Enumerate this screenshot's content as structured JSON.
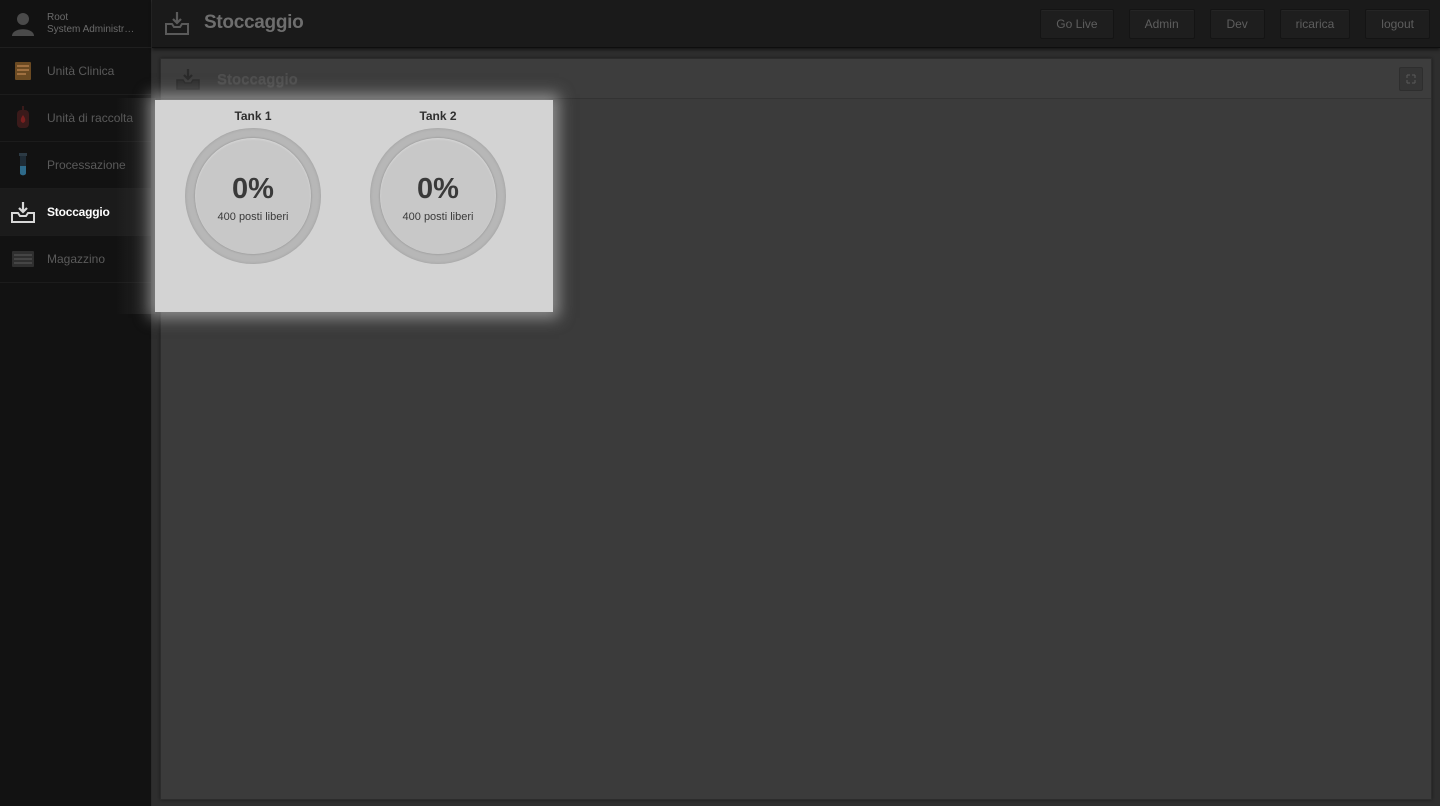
{
  "user": {
    "name": "Root",
    "role": "System Administr…"
  },
  "sidebar": {
    "items": [
      {
        "label": "Unità Clinica",
        "icon": "clipboard-icon",
        "active": false
      },
      {
        "label": "Unità di raccolta",
        "icon": "blood-bag-icon",
        "active": false
      },
      {
        "label": "Processazione",
        "icon": "test-tube-icon",
        "active": false
      },
      {
        "label": "Stoccaggio",
        "icon": "inbox-download-icon",
        "active": true
      },
      {
        "label": "Magazzino",
        "icon": "archive-icon",
        "active": false
      }
    ]
  },
  "topbar": {
    "title": "Stoccaggio",
    "buttons": [
      "Go Live",
      "Admin",
      "Dev",
      "ricarica",
      "logout"
    ]
  },
  "panel": {
    "title": "Stoccaggio",
    "tanks": [
      {
        "name": "Tank 1",
        "percent": "0%",
        "free": "400 posti liberi"
      },
      {
        "name": "Tank 2",
        "percent": "0%",
        "free": "400 posti liberi"
      }
    ]
  },
  "colors": {
    "sidebar_bg": "#121212",
    "topbar_bg": "#1a1a1a",
    "panel_bg": "#3b3b3b",
    "spotlight_bg": "#d3d3d3",
    "active_text": "#ffffff"
  }
}
